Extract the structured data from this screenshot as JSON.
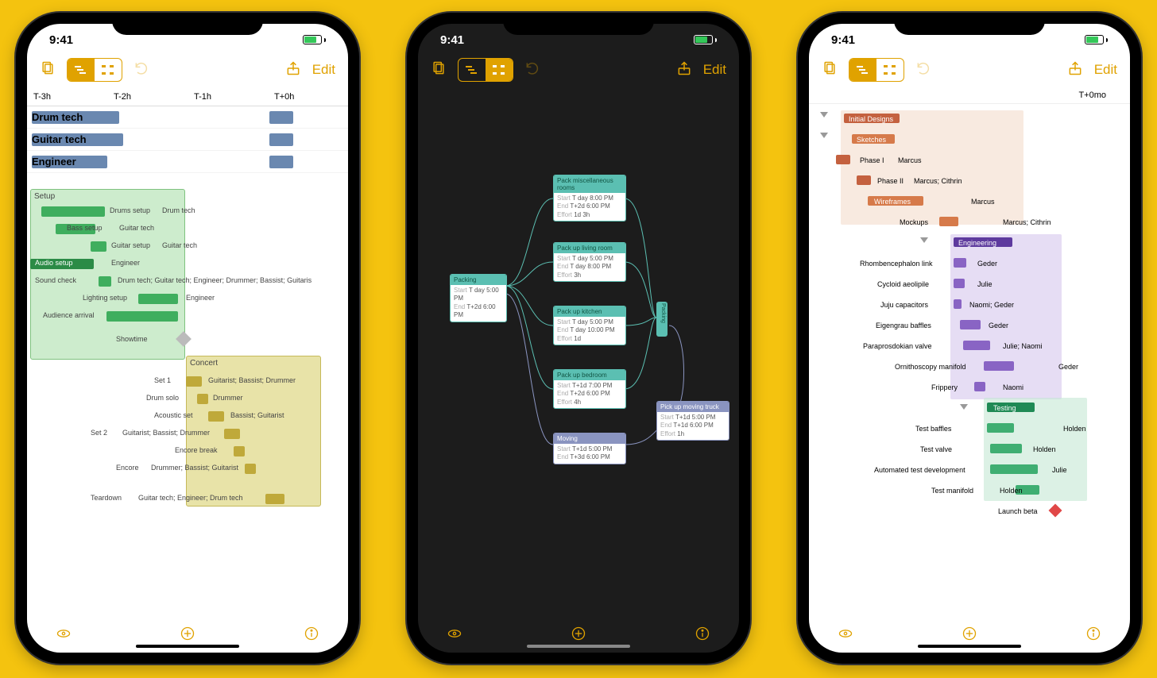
{
  "status_time": "9:41",
  "toolbar": {
    "edit": "Edit",
    "doc_icon": "document-icon",
    "view_icon": "view-mode-segment",
    "undo_icon": "undo-icon",
    "share_icon": "share-icon"
  },
  "footer": {
    "eye": "visibility-icon",
    "add": "add-icon",
    "info": "info-icon"
  },
  "phone1": {
    "timescale": [
      "T-3h",
      "T-2h",
      "T-1h",
      "T+0h"
    ],
    "resources": [
      "Drum tech",
      "Guitar tech",
      "Engineer"
    ],
    "groups": {
      "setup": "Setup",
      "concert": "Concert"
    },
    "tasks": [
      {
        "name": "Drums setup",
        "res": "Drum tech"
      },
      {
        "name": "Bass setup",
        "res": "Guitar tech"
      },
      {
        "name": "Guitar setup",
        "res": "Guitar tech"
      },
      {
        "name": "Audio setup",
        "res": "Engineer"
      },
      {
        "name": "Sound check",
        "res": "Drum tech; Guitar tech; Engineer; Drummer; Bassist; Guitaris"
      },
      {
        "name": "Lighting setup",
        "res": "Engineer"
      },
      {
        "name": "Audience arrival",
        "res": ""
      },
      {
        "name": "Showtime",
        "res": ""
      },
      {
        "name": "Set 1",
        "res": "Guitarist; Bassist; Drummer"
      },
      {
        "name": "Drum solo",
        "res": "Drummer"
      },
      {
        "name": "Acoustic set",
        "res": "Bassist; Guitarist"
      },
      {
        "name": "Set 2",
        "res": "Guitarist; Bassist; Drummer"
      },
      {
        "name": "Encore break",
        "res": ""
      },
      {
        "name": "Encore",
        "res": "Drummer; Bassist; Guitarist"
      },
      {
        "name": "Teardown",
        "res": "Guitar tech; Engineer; Drum tech"
      }
    ]
  },
  "phone2": {
    "root": {
      "name": "Packing",
      "start": "T day 5:00 PM",
      "end": "T+2d 6:00 PM"
    },
    "subtasks": [
      {
        "name": "Pack miscellaneous rooms",
        "start": "T day 8:00 PM",
        "end": "T+2d 6:00 PM",
        "effort": "1d 3h"
      },
      {
        "name": "Pack up living room",
        "start": "T day 5:00 PM",
        "end": "T day 8:00 PM",
        "effort": "3h"
      },
      {
        "name": "Pack up kitchen",
        "start": "T day 5:00 PM",
        "end": "T day 10:00 PM",
        "effort": "1d"
      },
      {
        "name": "Pack up bedroom",
        "start": "T+1d 7:00 PM",
        "end": "T+2d 6:00 PM",
        "effort": "4h"
      }
    ],
    "moving": {
      "name": "Moving",
      "start": "T+1d 5:00 PM",
      "end": "T+3d 6:00 PM"
    },
    "truck": {
      "name": "Pick up moving truck",
      "start": "T+1d 5:00 PM",
      "end": "T+1d 6:00 PM",
      "effort": "1h"
    },
    "link_lbl": "Packing"
  },
  "phone3": {
    "timescale": "T+0mo",
    "rows": [
      {
        "label": "Initial Designs",
        "assignee": "",
        "color": "or1",
        "type": "group"
      },
      {
        "label": "Sketches",
        "assignee": "",
        "color": "or2",
        "type": "group"
      },
      {
        "label": "Phase I",
        "assignee": "Marcus",
        "color": "or1"
      },
      {
        "label": "Phase II",
        "assignee": "Marcus; Cithrin",
        "color": "or1"
      },
      {
        "label": "Wireframes",
        "assignee": "Marcus",
        "color": "or2",
        "type": "hdr"
      },
      {
        "label": "Mockups",
        "assignee": "Marcus; Cithrin",
        "color": "or2"
      },
      {
        "label": "Engineering",
        "assignee": "",
        "color": "pu1",
        "type": "group"
      },
      {
        "label": "Rhombencephalon link",
        "assignee": "Geder",
        "color": "pu2"
      },
      {
        "label": "Cycloid aeolipile",
        "assignee": "Julie",
        "color": "pu2"
      },
      {
        "label": "Juju capacitors",
        "assignee": "Naomi; Geder",
        "color": "pu2"
      },
      {
        "label": "Eigengrau baffles",
        "assignee": "Geder",
        "color": "pu2"
      },
      {
        "label": "Paraprosdokian valve",
        "assignee": "Julie; Naomi",
        "color": "pu2"
      },
      {
        "label": "Ornithoscopy manifold",
        "assignee": "Geder",
        "color": "pu2"
      },
      {
        "label": "Frippery",
        "assignee": "Naomi",
        "color": "pu2"
      },
      {
        "label": "Testing",
        "assignee": "",
        "color": "gn1",
        "type": "group"
      },
      {
        "label": "Test baffles",
        "assignee": "Holden",
        "color": "gn2"
      },
      {
        "label": "Test valve",
        "assignee": "Holden",
        "color": "gn2"
      },
      {
        "label": "Automated test development",
        "assignee": "Julie",
        "color": "gn2"
      },
      {
        "label": "Test manifold",
        "assignee": "Holden",
        "color": "gn2"
      },
      {
        "label": "Launch beta",
        "assignee": "",
        "color": "red",
        "type": "milestone"
      }
    ]
  }
}
